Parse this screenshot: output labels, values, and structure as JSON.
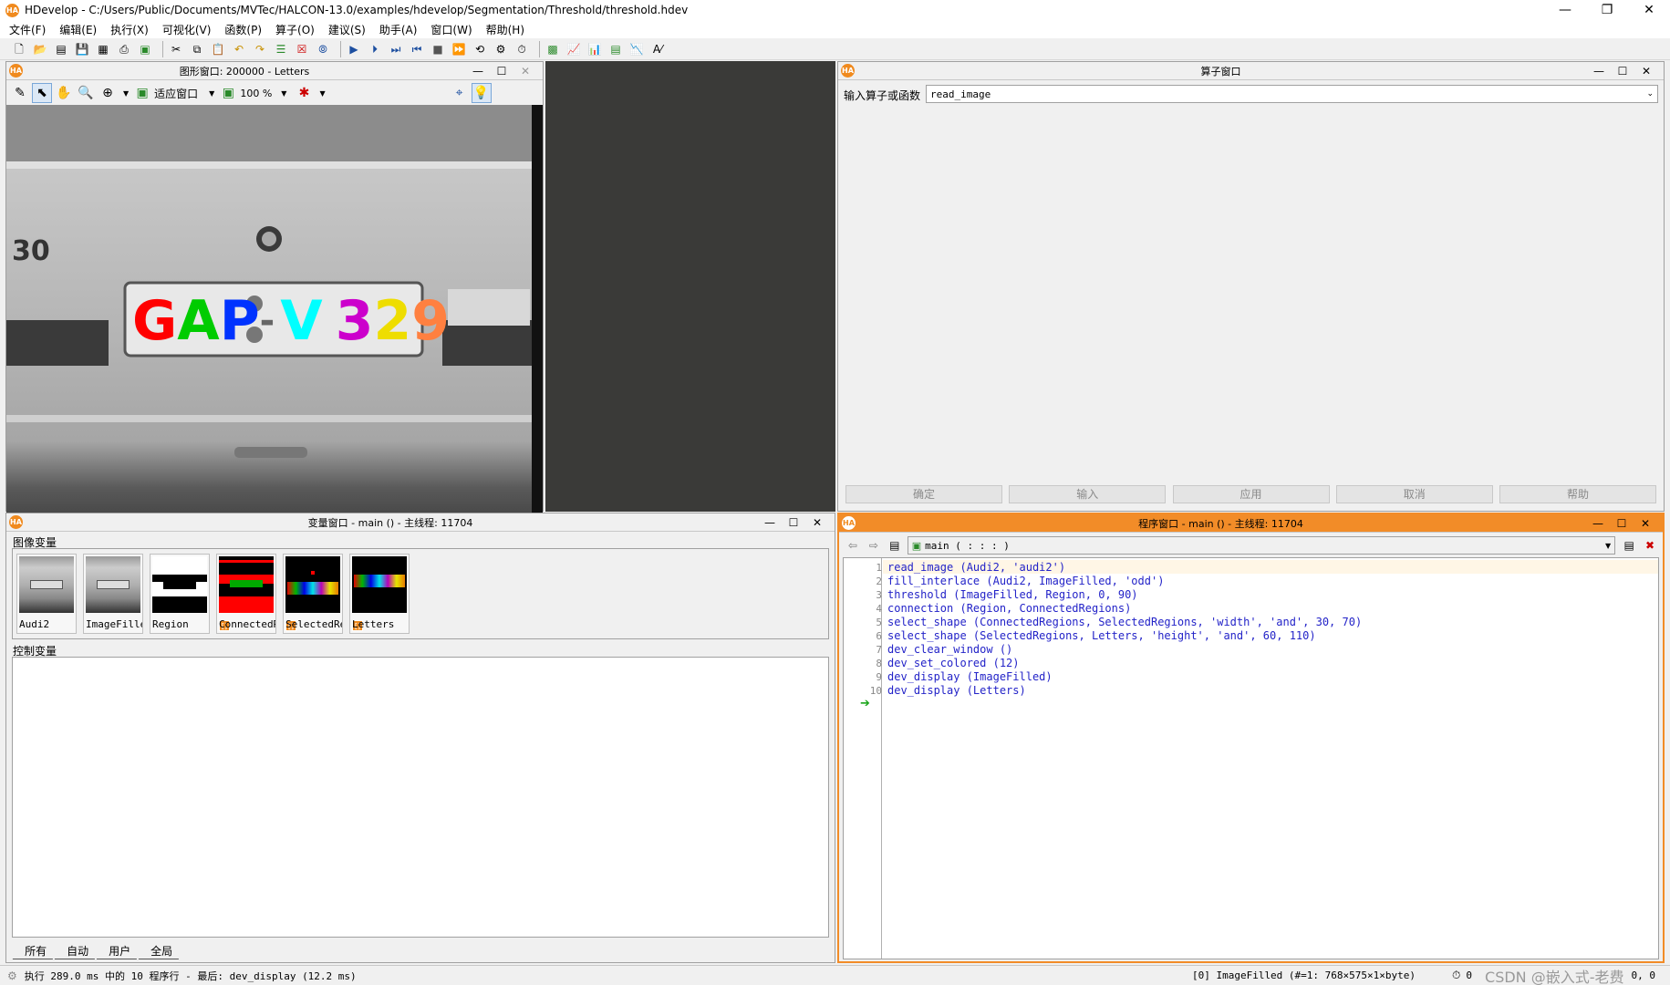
{
  "window": {
    "title": "HDevelop - C:/Users/Public/Documents/MVTec/HALCON-13.0/examples/hdevelop/Segmentation/Threshold/threshold.hdev",
    "logo": "HA"
  },
  "menu": [
    "文件(F)",
    "编辑(E)",
    "执行(X)",
    "可视化(V)",
    "函数(P)",
    "算子(O)",
    "建议(S)",
    "助手(A)",
    "窗口(W)",
    "帮助(H)"
  ],
  "graphics_window": {
    "title": "图形窗口: 200000 - Letters",
    "fit_label": "适应窗口",
    "zoom": "100 %",
    "plate_text": [
      "G",
      "A",
      "P",
      "-",
      "V",
      "3",
      "2",
      "9"
    ],
    "plate_colors": [
      "#ff0000",
      "#00cc00",
      "#0033ff",
      "#00cccc",
      "#00ffff",
      "#cc00cc",
      "#ffff00",
      "#ff8040"
    ]
  },
  "operator_window": {
    "title": "算子窗口",
    "input_label": "输入算子或函数",
    "input_value": "read_image",
    "buttons": [
      "确定",
      "输入",
      "应用",
      "取消",
      "帮助"
    ]
  },
  "variable_window": {
    "title": "变量窗口 - main () - 主线程: 11704",
    "iconic_label": "图像变量",
    "control_label": "控制变量",
    "thumbnails": [
      "Audi2",
      "ImageFilled",
      "Region",
      "ConnectedRegions",
      "SelectedRegions",
      "Letters"
    ],
    "tabs": [
      "所有",
      "自动",
      "用户",
      "全局"
    ]
  },
  "program_window": {
    "title": "程序窗口 - main () - 主线程: 11704",
    "procedure": "main ( : : : )",
    "lines": [
      "read_image (Audi2, 'audi2')",
      "fill_interlace (Audi2, ImageFilled, 'odd')",
      "threshold (ImageFilled, Region, 0, 90)",
      "connection (Region, ConnectedRegions)",
      "select_shape (ConnectedRegions, SelectedRegions, 'width', 'and', 30, 70)",
      "select_shape (SelectedRegions, Letters, 'height', 'and', 60, 110)",
      "dev_clear_window ()",
      "dev_set_colored (12)",
      "dev_display (ImageFilled)",
      "dev_display (Letters)"
    ],
    "line_numbers": [
      "1",
      "2",
      "3",
      "4",
      "5",
      "6",
      "7",
      "8",
      "9",
      "10"
    ]
  },
  "status": {
    "left": "执行 289.0 ms 中的 10 程序行 - 最后: dev_display (12.2 ms)",
    "right": "[0] ImageFilled (#=1: 768×575×1×byte)",
    "counter": "0",
    "coords": "0, 0",
    "watermark": "CSDN @嵌入式-老费"
  },
  "colors": {
    "accent": "#f28c28",
    "code": "#2323c8"
  }
}
